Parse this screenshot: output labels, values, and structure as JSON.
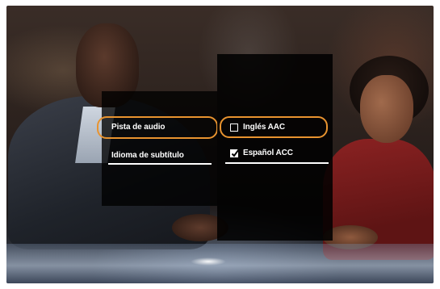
{
  "menu": {
    "categories": [
      {
        "label": "Pista de audio",
        "selected": true
      },
      {
        "label": "Idioma de subtítulo",
        "selected": false
      }
    ],
    "audio_tracks": [
      {
        "label": "Inglés AAC",
        "checked": false,
        "focused": true
      },
      {
        "label": "Español ACC",
        "checked": true,
        "focused": false
      }
    ]
  },
  "colors": {
    "highlight": "#e8932f",
    "panel": "#000000",
    "text": "#ffffff"
  },
  "icons": {
    "unchecked": "checkbox-unchecked-icon",
    "checked": "checkbox-checked-icon"
  }
}
